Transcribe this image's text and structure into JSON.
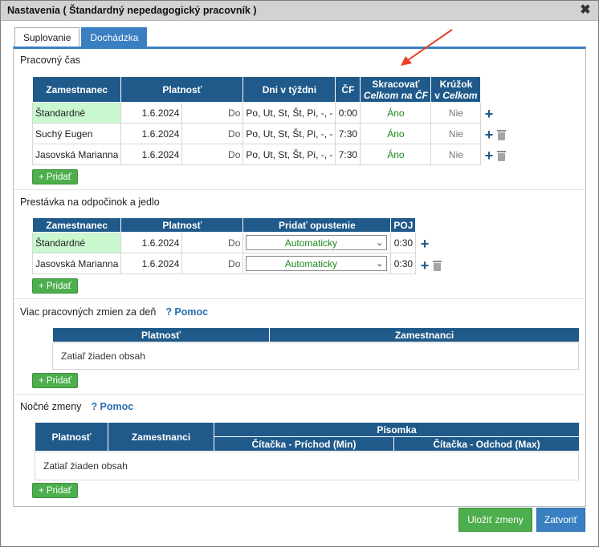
{
  "window": {
    "title": "Nastavenia ( Štandardný nepedagogický pracovník )",
    "close_glyph": "✖"
  },
  "tabs": [
    {
      "label": "Suplovanie",
      "active": false
    },
    {
      "label": "Dochádzka",
      "active": true
    }
  ],
  "work_time": {
    "title": "Pracovný čas",
    "headers": {
      "employee": "Zamestnanec",
      "validity": "Platnosť",
      "days": "Dni v týždni",
      "cf": "ČF",
      "shorten_l1": "Skracovať",
      "shorten_l2": "Celkom na ČF",
      "circle_l1": "Krúžok",
      "circle_l2a": "v ",
      "circle_l2b": "Celkom"
    },
    "rows": [
      {
        "employee": "Štandardné",
        "from": "1.6.2024",
        "to": "Do",
        "days": "Po, Ut, St, Št, Pi, -, -",
        "cf": "0:00",
        "shorten": "Áno",
        "circle": "Nie",
        "std": true
      },
      {
        "employee": "Suchý Eugen",
        "from": "1.6.2024",
        "to": "Do",
        "days": "Po, Ut, St, Št, Pi, -, -",
        "cf": "7:30",
        "shorten": "Áno",
        "circle": "Nie",
        "std": false
      },
      {
        "employee": "Jasovská Marianna",
        "from": "1.6.2024",
        "to": "Do",
        "days": "Po, Ut, St, Št, Pi, -, -",
        "cf": "7:30",
        "shorten": "Áno",
        "circle": "Nie",
        "std": false
      }
    ],
    "add_label": "+ Pridať"
  },
  "breaks": {
    "title": "Prestávka na odpočinok a jedlo",
    "headers": {
      "employee": "Zamestnanec",
      "validity": "Platnosť",
      "add_leave": "Pridať opustenie",
      "poj": "POJ"
    },
    "rows": [
      {
        "employee": "Štandardné",
        "from": "1.6.2024",
        "to": "Do",
        "select": "Automaticky",
        "poj": "0:30",
        "std": true
      },
      {
        "employee": "Jasovská Marianna",
        "from": "1.6.2024",
        "to": "Do",
        "select": "Automaticky",
        "poj": "0:30",
        "std": false
      }
    ],
    "add_label": "+ Pridať"
  },
  "multi_shifts": {
    "title": "Viac pracovných zmien za deň",
    "help": "? Pomoc",
    "headers": {
      "validity": "Platnosť",
      "employees": "Zamestnanci"
    },
    "empty": "Zatiaľ žiaden obsah",
    "add_label": "+ Pridať"
  },
  "night_shifts": {
    "title": "Nočné zmeny",
    "help": "? Pomoc",
    "headers": {
      "validity": "Platnosť",
      "employees": "Zamestnanci",
      "letter": "Písomka",
      "reader_in": "Čítačka - Príchod (Min)",
      "reader_out": "Čítačka - Odchod (Max)"
    },
    "empty": "Zatiaľ žiaden obsah",
    "add_label": "+ Pridať"
  },
  "footer": {
    "save": "Uložiť zmeny",
    "close": "Zatvoriť"
  },
  "colors": {
    "header_blue": "#1f5a8a",
    "accent_blue": "#3a7fc1",
    "green_btn": "#4cae4c",
    "std_row": "#c8f7d0",
    "annotation_arrow": "#e8402a"
  }
}
